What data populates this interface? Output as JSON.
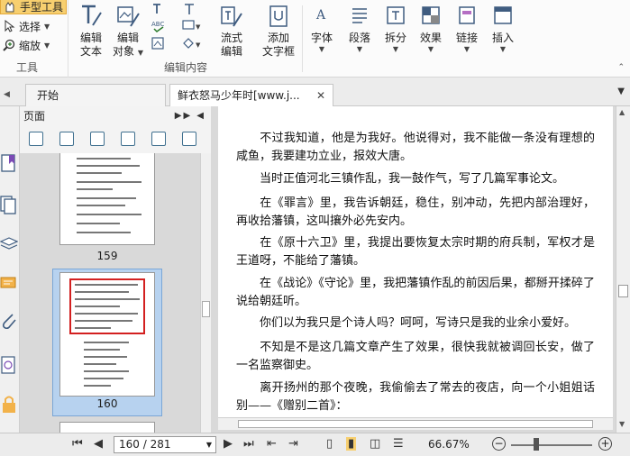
{
  "ribbon": {
    "tools": {
      "hand_tool": "手型工具",
      "select": "选择",
      "zoom": "缩放",
      "group_label": "工具"
    },
    "edit": {
      "edit_text": [
        "编辑",
        "文本"
      ],
      "edit_object": [
        "编辑",
        "对象"
      ],
      "flow_edit": [
        "流式",
        "编辑"
      ],
      "add_textbox": [
        "添加",
        "文字框"
      ],
      "group_label": "编辑内容"
    },
    "format": {
      "font": "字体",
      "paragraph": "段落",
      "split": "拆分",
      "effects": "效果",
      "link": "链接",
      "insert": "插入"
    }
  },
  "tabs": {
    "start": "开始",
    "document": "鲜衣怒马少年时[www.j...",
    "close": "✕"
  },
  "panel": {
    "title": "页面",
    "thumbnails": [
      {
        "page": "159"
      },
      {
        "page": "160",
        "selected": true
      }
    ]
  },
  "document": {
    "paragraphs": [
      "不过我知道，他是为我好。他说得对，我不能做一条没有理想的咸鱼，我要建功立业，报效大唐。",
      "当时正值河北三镇作乱，我一鼓作气，写了几篇军事论文。",
      "在《罪言》里，我告诉朝廷，稳住，别冲动，先把内部治理好，再收拾藩镇，这叫攘外必先安内。",
      "在《原十六卫》里，我提出要恢复太宗时期的府兵制，军权才是王道呀，不能给了藩镇。",
      "在《战论》《守论》里，我把藩镇作乱的前因后果，都掰开揉碎了说给朝廷听。",
      "你们以为我只是个诗人吗？呵呵，写诗只是我的业余小爱好。",
      "不知是不是这几篇文章产生了效果，很快我就被调回长安，做了一名监察御史。",
      "离开扬州的那个夜晚，我偷偷去了常去的夜店，向一个小姐姐话别——《赠别二首》："
    ]
  },
  "statusbar": {
    "page_indicator": "160 / 281",
    "zoom": "66.67%"
  },
  "colors": {
    "accent_blue": "#3f5c80",
    "selection": "#b7d2ef",
    "hand_tool_bg": "#f7cf6f",
    "highlight_red": "#d32020"
  }
}
